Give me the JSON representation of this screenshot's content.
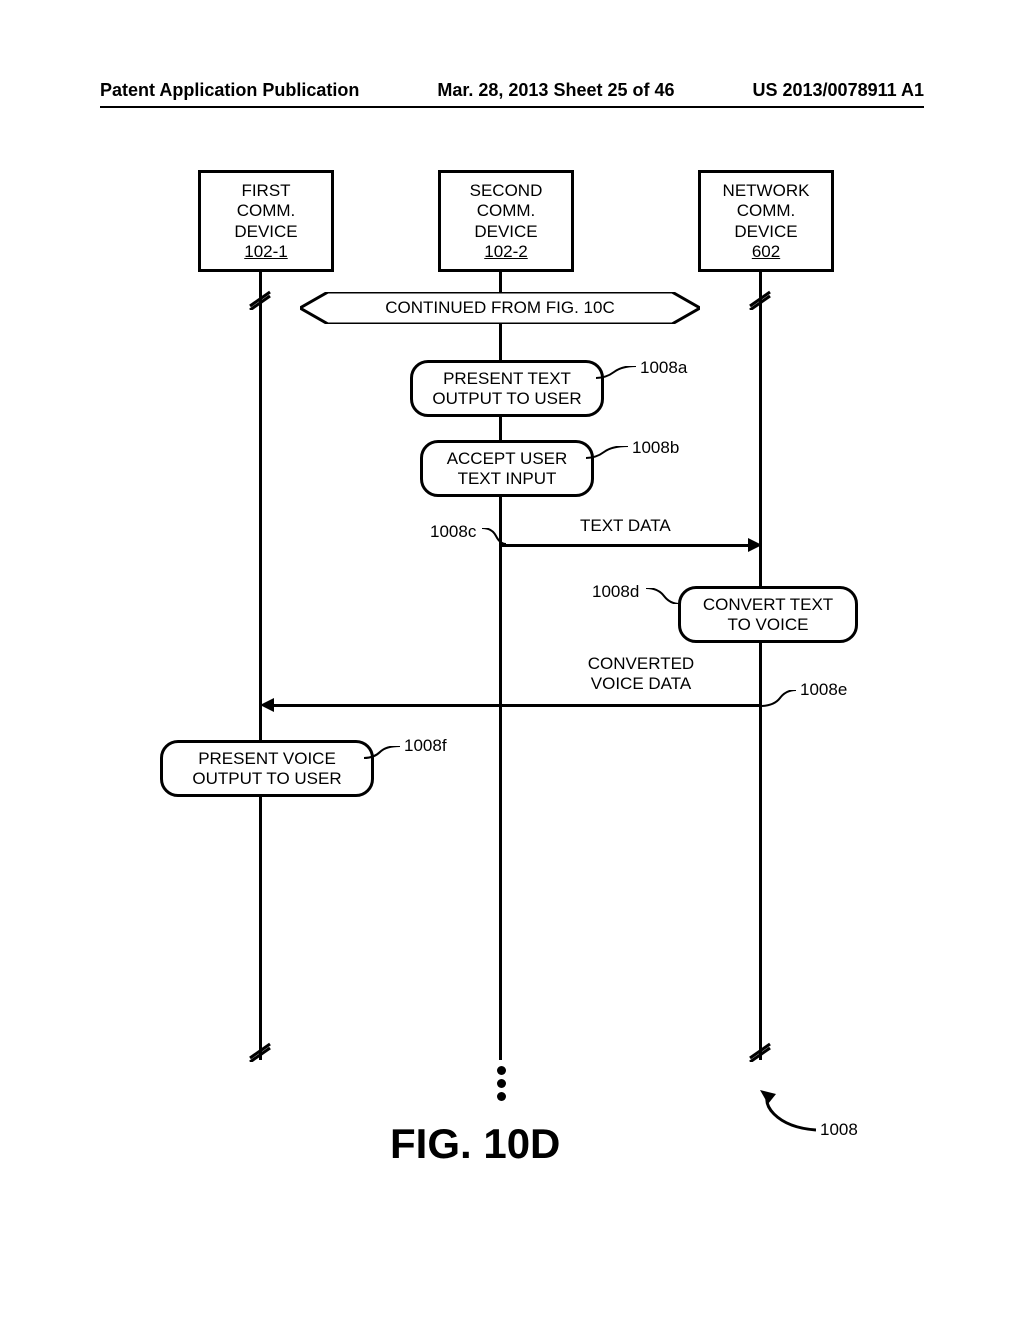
{
  "header": {
    "left": "Patent Application Publication",
    "center": "Mar. 28, 2013  Sheet 25 of 46",
    "right": "US 2013/0078911 A1"
  },
  "actors": {
    "first": {
      "l1": "FIRST",
      "l2": "COMM.",
      "l3": "DEVICE",
      "ref": "102-1"
    },
    "second": {
      "l1": "SECOND",
      "l2": "COMM.",
      "l3": "DEVICE",
      "ref": "102-2"
    },
    "network": {
      "l1": "NETWORK",
      "l2": "COMM.",
      "l3": "DEVICE",
      "ref": "602"
    }
  },
  "continued": "CONTINUED FROM FIG. 10C",
  "steps": {
    "s1008a": {
      "ref": "1008a",
      "l1": "PRESENT TEXT",
      "l2": "OUTPUT TO USER"
    },
    "s1008b": {
      "ref": "1008b",
      "l1": "ACCEPT USER",
      "l2": "TEXT INPUT"
    },
    "s1008c": {
      "ref": "1008c",
      "msg": "TEXT DATA"
    },
    "s1008d": {
      "ref": "1008d",
      "l1": "CONVERT TEXT",
      "l2": "TO VOICE"
    },
    "s1008e": {
      "ref": "1008e",
      "msg_l1": "CONVERTED",
      "msg_l2": "VOICE DATA"
    },
    "s1008f": {
      "ref": "1008f",
      "l1": "PRESENT VOICE",
      "l2": "OUTPUT TO USER"
    }
  },
  "figure": {
    "caption": "FIG. 10D",
    "num": "1008"
  }
}
